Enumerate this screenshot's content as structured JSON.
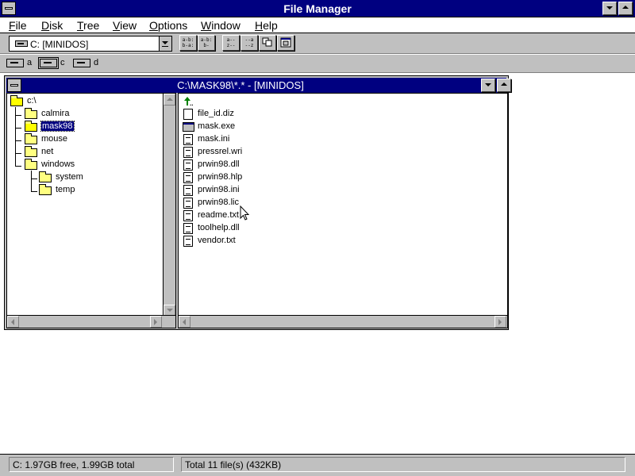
{
  "app": {
    "title": "File Manager"
  },
  "menu": [
    {
      "key": "F",
      "rest": "ile"
    },
    {
      "key": "D",
      "rest": "isk"
    },
    {
      "key": "T",
      "rest": "ree"
    },
    {
      "key": "V",
      "rest": "iew"
    },
    {
      "key": "O",
      "rest": "ptions"
    },
    {
      "key": "W",
      "rest": "indow"
    },
    {
      "key": "H",
      "rest": "elp"
    }
  ],
  "toolbar": {
    "drive_select_value": "C: [MINIDOS]",
    "buttons": [
      {
        "name": "connect-drive-icon",
        "glyph": "a-b:\nb-a:"
      },
      {
        "name": "disconnect-drive-icon",
        "glyph": "a-b:\nb-"
      },
      {
        "name": "sort-by-name-icon",
        "glyph": "a--\nz--"
      },
      {
        "name": "sort-by-type-icon",
        "glyph": "--a\n--z"
      },
      {
        "name": "copy-disk-icon",
        "glyph": ""
      },
      {
        "name": "properties-icon",
        "glyph": ""
      }
    ]
  },
  "drives": [
    {
      "label": "a"
    },
    {
      "label": "c"
    },
    {
      "label": "d"
    }
  ],
  "window": {
    "title": "C:\\MASK98\\*.* - [MINIDOS]"
  },
  "tree": [
    {
      "label": "c:\\"
    },
    {
      "label": "calmira"
    },
    {
      "label": "mask98"
    },
    {
      "label": "mouse"
    },
    {
      "label": "net"
    },
    {
      "label": "windows"
    },
    {
      "label": "system"
    },
    {
      "label": "temp"
    }
  ],
  "files": [
    {
      "label": "file_id.diz"
    },
    {
      "label": "mask.exe"
    },
    {
      "label": "mask.ini"
    },
    {
      "label": "pressrel.wri"
    },
    {
      "label": "prwin98.dll"
    },
    {
      "label": "prwin98.hlp"
    },
    {
      "label": "prwin98.ini"
    },
    {
      "label": "prwin98.lic"
    },
    {
      "label": "readme.txt"
    },
    {
      "label": "toolhelp.dll"
    },
    {
      "label": "vendor.txt"
    }
  ],
  "status": {
    "disk": "C: 1.97GB free,  1.99GB total",
    "files": "Total 11 file(s) (432KB)"
  },
  "colors": {
    "title_bar": "#000080",
    "face": "#c0c0c0",
    "folder": "#ffff80",
    "selection": "#000080"
  }
}
